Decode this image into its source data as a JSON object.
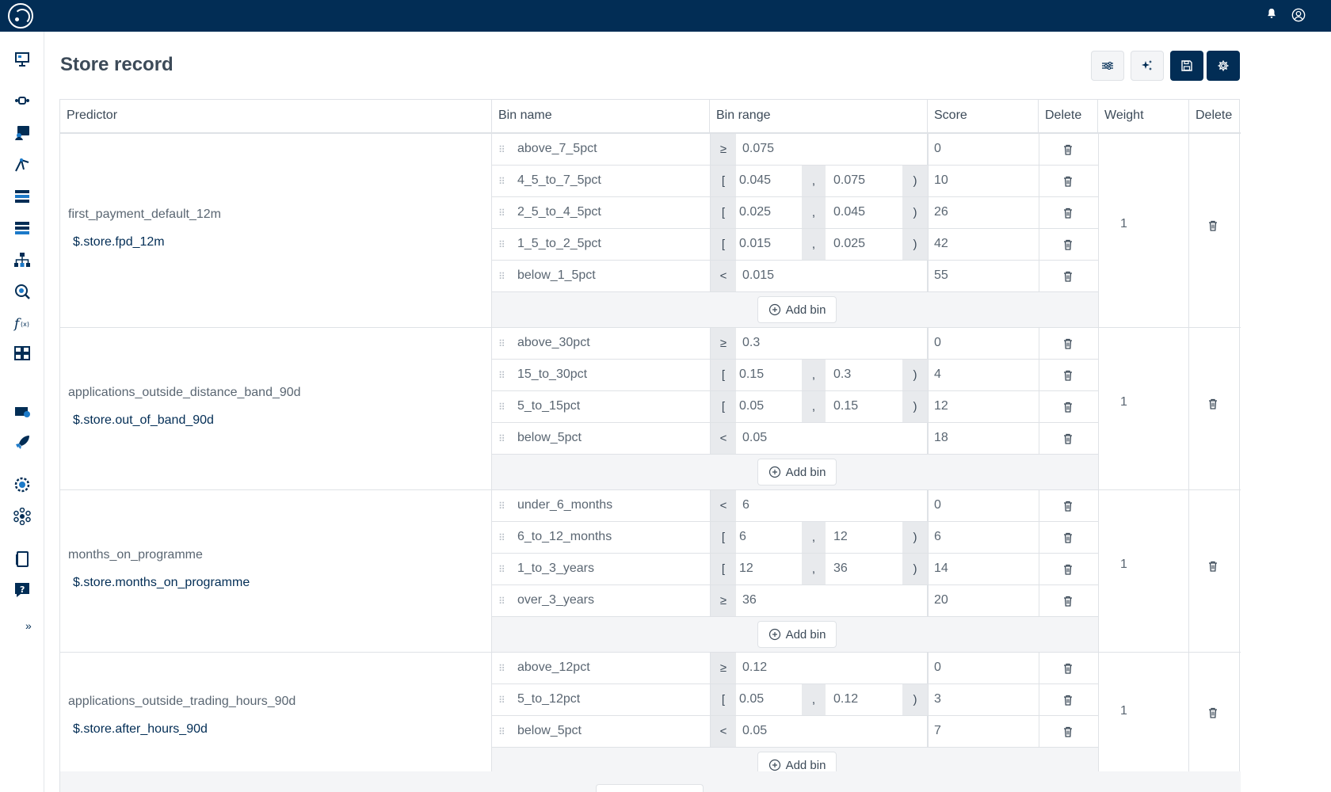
{
  "page": {
    "title": "Store record"
  },
  "toolbar": {
    "buttons": [
      "sliders-icon",
      "sparkle-icon",
      "save-icon",
      "gear-icon"
    ]
  },
  "header": {
    "predictor": "Predictor",
    "bin_name": "Bin name",
    "bin_range": "Bin range",
    "score": "Score",
    "delete_bin": "Delete",
    "weight": "Weight",
    "delete_predictor": "Delete"
  },
  "add_bin_label": "Add bin",
  "predictors": [
    {
      "name": "first_payment_default_12m",
      "path": "$.store.fpd_12m",
      "weight": "1",
      "bins": [
        {
          "name": "above_7_5pct",
          "op": "≥",
          "value": "0.075",
          "score": "0"
        },
        {
          "name": "4_5_to_7_5pct",
          "op": "[",
          "lo": "0.045",
          "hi": "0.075",
          "score": "10"
        },
        {
          "name": "2_5_to_4_5pct",
          "op": "[",
          "lo": "0.025",
          "hi": "0.045",
          "score": "26"
        },
        {
          "name": "1_5_to_2_5pct",
          "op": "[",
          "lo": "0.015",
          "hi": "0.025",
          "score": "42"
        },
        {
          "name": "below_1_5pct",
          "op": "<",
          "value": "0.015",
          "score": "55"
        }
      ]
    },
    {
      "name": "applications_outside_distance_band_90d",
      "path": "$.store.out_of_band_90d",
      "weight": "1",
      "bins": [
        {
          "name": "above_30pct",
          "op": "≥",
          "value": "0.3",
          "score": "0"
        },
        {
          "name": "15_to_30pct",
          "op": "[",
          "lo": "0.15",
          "hi": "0.3",
          "score": "4"
        },
        {
          "name": "5_to_15pct",
          "op": "[",
          "lo": "0.05",
          "hi": "0.15",
          "score": "12"
        },
        {
          "name": "below_5pct",
          "op": "<",
          "value": "0.05",
          "score": "18"
        }
      ]
    },
    {
      "name": "months_on_programme",
      "path": "$.store.months_on_programme",
      "weight": "1",
      "bins": [
        {
          "name": "under_6_months",
          "op": "<",
          "value": "6",
          "score": "0"
        },
        {
          "name": "6_to_12_months",
          "op": "[",
          "lo": "6",
          "hi": "12",
          "score": "6"
        },
        {
          "name": "1_to_3_years",
          "op": "[",
          "lo": "12",
          "hi": "36",
          "score": "14"
        },
        {
          "name": "over_3_years",
          "op": "≥",
          "value": "36",
          "score": "20"
        }
      ]
    },
    {
      "name": "applications_outside_trading_hours_90d",
      "path": "$.store.after_hours_90d",
      "weight": "1",
      "bins": [
        {
          "name": "above_12pct",
          "op": "≥",
          "value": "0.12",
          "score": "0"
        },
        {
          "name": "5_to_12pct",
          "op": "[",
          "lo": "0.05",
          "hi": "0.12",
          "score": "3"
        },
        {
          "name": "below_5pct",
          "op": "<",
          "value": "0.05",
          "score": "7"
        }
      ]
    }
  ],
  "colors": {
    "brand_dark": "#022d55",
    "border": "#dfe2e6",
    "muted_bg": "#f4f5f7"
  }
}
